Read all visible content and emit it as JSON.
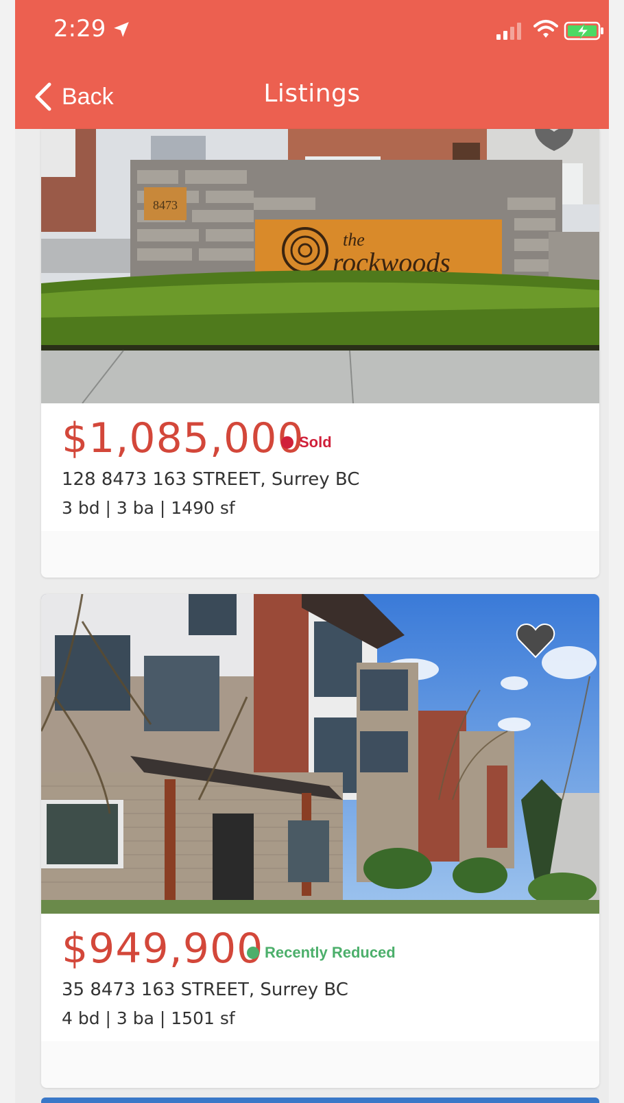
{
  "status_bar": {
    "time": "2:29"
  },
  "nav": {
    "back_label": "Back",
    "title": "Listings"
  },
  "colors": {
    "accent": "#ec6050",
    "price": "#d3473a",
    "sold": "#d0203a",
    "reduced": "#4caf6b"
  },
  "listings": [
    {
      "price": "$1,085,000",
      "status": "Sold",
      "address": "128 8473 163 STREET, Surrey BC",
      "specs": "3 bd | 3 ba | 1490 sf",
      "sign_number": "8473",
      "sign_text_1": "the",
      "sign_text_2": "rockwoods"
    },
    {
      "price": "$949,900",
      "status": "Recently Reduced",
      "address": "35 8473 163 STREET, Surrey BC",
      "specs": "4 bd | 3 ba | 1501 sf"
    }
  ]
}
